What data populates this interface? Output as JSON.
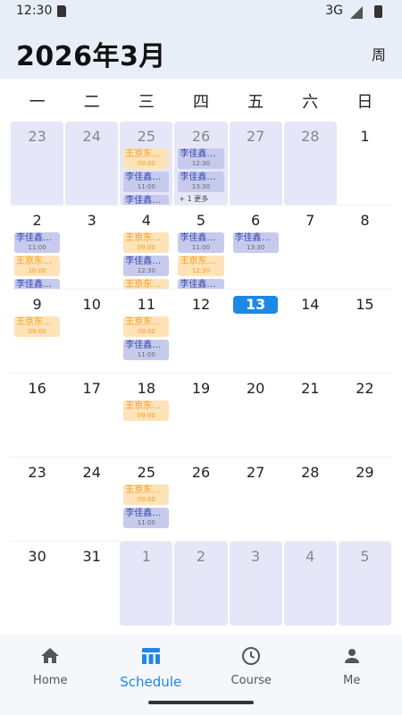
{
  "status": {
    "time": "12:30",
    "network": "3G"
  },
  "header": {
    "title": "2026年3月",
    "view_toggle": "周"
  },
  "weekdays": [
    "一",
    "二",
    "三",
    "四",
    "五",
    "六",
    "日"
  ],
  "weeks": [
    [
      {
        "day": "23",
        "outside": true,
        "events": []
      },
      {
        "day": "24",
        "outside": true,
        "events": []
      },
      {
        "day": "25",
        "outside": true,
        "events": [
          {
            "title": "王京东物…",
            "time": "09:00",
            "color": "orange"
          },
          {
            "title": "李佳鑫钢…",
            "time": "11:00",
            "color": "blue"
          },
          {
            "title": "李佳鑫钢…",
            "time": "",
            "color": "blue"
          }
        ]
      },
      {
        "day": "26",
        "outside": true,
        "events": [
          {
            "title": "李佳鑫钢…",
            "time": "12:30",
            "color": "blue"
          },
          {
            "title": "李佳鑫钢…",
            "time": "13:30",
            "color": "blue"
          }
        ],
        "more": "+ 1 更多"
      },
      {
        "day": "27",
        "outside": true,
        "events": []
      },
      {
        "day": "28",
        "outside": true,
        "events": []
      },
      {
        "day": "1",
        "outside": false,
        "events": []
      }
    ],
    [
      {
        "day": "2",
        "events": [
          {
            "title": "李佳鑫钢…",
            "time": "11:00",
            "color": "blue"
          },
          {
            "title": "王京东物…",
            "time": "10:00",
            "color": "orange"
          },
          {
            "title": "李佳鑫钢…",
            "time": "",
            "color": "blue"
          }
        ]
      },
      {
        "day": "3",
        "events": []
      },
      {
        "day": "4",
        "events": [
          {
            "title": "王京东物…",
            "time": "09:00",
            "color": "orange"
          },
          {
            "title": "李佳鑫钢…",
            "time": "12:30",
            "color": "blue"
          },
          {
            "title": "王京东物…",
            "time": "",
            "color": "orange"
          }
        ]
      },
      {
        "day": "5",
        "events": [
          {
            "title": "李佳鑫钢…",
            "time": "11:00",
            "color": "blue"
          },
          {
            "title": "王京东物…",
            "time": "12:30",
            "color": "orange"
          },
          {
            "title": "李佳鑫钢…",
            "time": "",
            "color": "blue"
          }
        ]
      },
      {
        "day": "6",
        "events": [
          {
            "title": "李佳鑫钢…",
            "time": "13:30",
            "color": "blue"
          }
        ]
      },
      {
        "day": "7",
        "events": []
      },
      {
        "day": "8",
        "events": []
      }
    ],
    [
      {
        "day": "9",
        "events": [
          {
            "title": "王京东物…",
            "time": "09:00",
            "color": "orange"
          }
        ]
      },
      {
        "day": "10",
        "events": []
      },
      {
        "day": "11",
        "events": [
          {
            "title": "王京东物…",
            "time": "09:00",
            "color": "orange"
          },
          {
            "title": "李佳鑫钢…",
            "time": "11:00",
            "color": "blue"
          }
        ]
      },
      {
        "day": "12",
        "events": []
      },
      {
        "day": "13",
        "today": true,
        "events": []
      },
      {
        "day": "14",
        "events": []
      },
      {
        "day": "15",
        "events": []
      }
    ],
    [
      {
        "day": "16",
        "events": []
      },
      {
        "day": "17",
        "events": []
      },
      {
        "day": "18",
        "events": [
          {
            "title": "王京东物…",
            "time": "09:00",
            "color": "orange"
          }
        ]
      },
      {
        "day": "19",
        "events": []
      },
      {
        "day": "20",
        "events": []
      },
      {
        "day": "21",
        "events": []
      },
      {
        "day": "22",
        "events": []
      }
    ],
    [
      {
        "day": "23",
        "events": []
      },
      {
        "day": "24",
        "events": []
      },
      {
        "day": "25",
        "events": [
          {
            "title": "王京东物…",
            "time": "09:00",
            "color": "orange"
          },
          {
            "title": "李佳鑫钢…",
            "time": "11:00",
            "color": "blue"
          }
        ]
      },
      {
        "day": "26",
        "events": []
      },
      {
        "day": "27",
        "events": []
      },
      {
        "day": "28",
        "events": []
      },
      {
        "day": "29",
        "events": []
      }
    ],
    [
      {
        "day": "30",
        "events": []
      },
      {
        "day": "31",
        "events": []
      },
      {
        "day": "1",
        "outside": true,
        "events": []
      },
      {
        "day": "2",
        "outside": true,
        "events": []
      },
      {
        "day": "3",
        "outside": true,
        "events": []
      },
      {
        "day": "4",
        "outside": true,
        "events": []
      },
      {
        "day": "5",
        "outside": true,
        "events": []
      }
    ]
  ],
  "nav": [
    {
      "label": "Home",
      "icon": "home-icon"
    },
    {
      "label": "Schedule",
      "icon": "schedule-icon",
      "active": true
    },
    {
      "label": "Course",
      "icon": "clock-icon"
    },
    {
      "label": "Me",
      "icon": "person-icon"
    }
  ],
  "colors": {
    "accent": "#1e88e5",
    "orange_event_bg": "#ffe3b8",
    "blue_event_bg": "#c6cbee",
    "outside_day_bg": "#e5e6f7"
  }
}
